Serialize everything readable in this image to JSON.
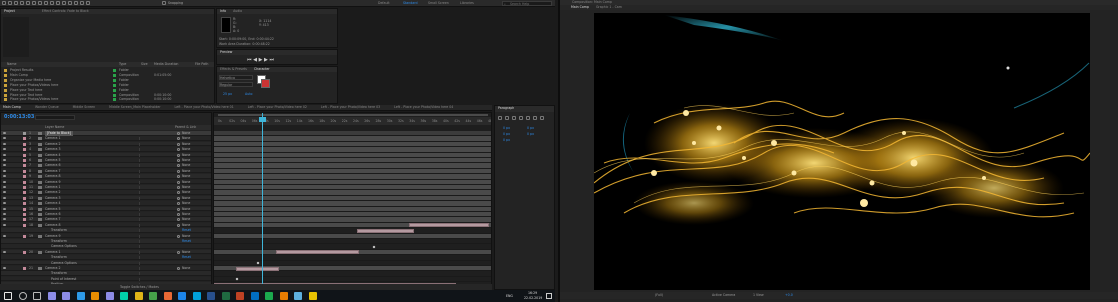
{
  "menubar": {
    "workspaces": [
      "Default",
      "Standard",
      "Small Screen",
      "Libraries"
    ],
    "active_workspace": "Standard",
    "snapping_label": "Snapping",
    "search_placeholder": "Search Help"
  },
  "project": {
    "title": "Project",
    "effect_controls_tab": "Effect Controls: Fade to Black",
    "columns": [
      "Name",
      "Type",
      "Size",
      "Media Duration",
      "File Path"
    ],
    "items": [
      {
        "name": "Project Results",
        "type": "Folder",
        "dur": ""
      },
      {
        "name": "Main Comp",
        "type": "Composition",
        "dur": "0:01:05:00"
      },
      {
        "name": "Organize your Media here",
        "type": "Folder",
        "dur": ""
      },
      {
        "name": "Place your Photos/Videos here",
        "type": "Folder",
        "dur": ""
      },
      {
        "name": "Place your Text here",
        "type": "Folder",
        "dur": ""
      },
      {
        "name": "Place your Text here",
        "type": "Composition",
        "dur": "0:00:10:00"
      },
      {
        "name": "Place your Photos/Videos here",
        "type": "Composition",
        "dur": "0:00:10:00"
      }
    ]
  },
  "info_panel": {
    "tabs": [
      "Info",
      "Audio"
    ],
    "lines": [
      "R:",
      "G:",
      "B:",
      "A: 0",
      "X: 1114",
      "Y: 413"
    ],
    "start_line": "Start: 0:00:09:00, End: 0:00:44:22",
    "work_line": "Work Area Duration: 0:00:48:22"
  },
  "preview_panel": {
    "title": "Preview"
  },
  "effects_panel": {
    "tabs": [
      "Effects & Presets",
      "Character"
    ],
    "font": "Helvetica",
    "style": "Regular",
    "size": "25 px",
    "leading": "Auto"
  },
  "timeline_tabs": [
    "Main Comp",
    "Wonder Queue",
    "Middle Screen",
    "Middle Screen_Main Placeholder",
    "Left - Place your Photo/Video here 01",
    "Left - Place your Photo/Video here 02",
    "Left - Place your Photo/Video here 03",
    "Left - Place your Photo/Video here 04"
  ],
  "timeline": {
    "timecode": "0:00:13:03",
    "layer_header": "Layer Name",
    "parent_header": "Parent & Link",
    "ruler": [
      "0s",
      "02s",
      "04s",
      "06s",
      "08s",
      "10s",
      "12s",
      "14s",
      "16s",
      "18s",
      "20s",
      "22s",
      "24s",
      "26s",
      "28s",
      "30s",
      "32s",
      "34s",
      "36s",
      "38s",
      "40s",
      "42s",
      "44s",
      "46s",
      "48s"
    ],
    "layers": [
      {
        "num": "1",
        "name": "[Fade to Black]",
        "parent": "None",
        "kind": "layer"
      },
      {
        "num": "2",
        "name": "Camera 1",
        "parent": "None",
        "kind": "layer"
      },
      {
        "num": "3",
        "name": "Camera 2",
        "parent": "None",
        "kind": "layer"
      },
      {
        "num": "4",
        "name": "Camera 3",
        "parent": "None",
        "kind": "layer"
      },
      {
        "num": "5",
        "name": "Camera 4",
        "parent": "None",
        "kind": "layer"
      },
      {
        "num": "6",
        "name": "Camera 5",
        "parent": "None",
        "kind": "layer"
      },
      {
        "num": "7",
        "name": "Camera 6",
        "parent": "None",
        "kind": "layer"
      },
      {
        "num": "8",
        "name": "Camera 7",
        "parent": "None",
        "kind": "layer"
      },
      {
        "num": "9",
        "name": "Camera 8",
        "parent": "None",
        "kind": "layer"
      },
      {
        "num": "10",
        "name": "Camera 9",
        "parent": "None",
        "kind": "layer"
      },
      {
        "num": "11",
        "name": "Camera 1",
        "parent": "None",
        "kind": "layer"
      },
      {
        "num": "12",
        "name": "Camera 2",
        "parent": "None",
        "kind": "layer"
      },
      {
        "num": "13",
        "name": "Camera 3",
        "parent": "None",
        "kind": "layer"
      },
      {
        "num": "14",
        "name": "Camera 4",
        "parent": "None",
        "kind": "layer"
      },
      {
        "num": "15",
        "name": "Camera 5",
        "parent": "None",
        "kind": "layer"
      },
      {
        "num": "16",
        "name": "Camera 6",
        "parent": "None",
        "kind": "layer"
      },
      {
        "num": "17",
        "name": "Camera 7",
        "parent": "None",
        "kind": "layer"
      },
      {
        "num": "18",
        "name": "Camera 8",
        "parent": "None",
        "kind": "layer"
      },
      {
        "num": "",
        "name": "Transform",
        "parent": "Reset",
        "kind": "sub"
      },
      {
        "num": "19",
        "name": "Camera 9",
        "parent": "None",
        "kind": "layer"
      },
      {
        "num": "",
        "name": "Transform",
        "parent": "Reset",
        "kind": "sub"
      },
      {
        "num": "",
        "name": "Camera Options",
        "parent": "",
        "kind": "sub"
      },
      {
        "num": "20",
        "name": "Camera 1",
        "parent": "None",
        "kind": "layer"
      },
      {
        "num": "",
        "name": "Transform",
        "parent": "Reset",
        "kind": "sub"
      },
      {
        "num": "",
        "name": "Camera Options",
        "parent": "",
        "kind": "sub"
      },
      {
        "num": "21",
        "name": "Camera 2",
        "parent": "None",
        "kind": "layer"
      },
      {
        "num": "",
        "name": "Transform",
        "parent": "",
        "kind": "sub"
      },
      {
        "num": "",
        "name": "Point of Interest",
        "parent": "",
        "kind": "sub"
      },
      {
        "num": "",
        "name": "Position",
        "parent": "",
        "kind": "sub"
      }
    ],
    "footer": "Toggle Switches / Modes"
  },
  "paragraph_panel": {
    "title": "Paragraph",
    "fields": [
      "0 px",
      "0 px",
      "0 px",
      "0 px",
      "0 px"
    ]
  },
  "viewer": {
    "title": "Composition: Main Comp",
    "tabs": [
      "Main Comp",
      "Graphic 1 - Cam"
    ],
    "footer_items": [
      "(Full)",
      "Active Camera",
      "1 View",
      "+0.0"
    ]
  },
  "taskbar": {
    "time": "16:29",
    "date": "22.02.2019",
    "lang": "ENG",
    "icons": [
      {
        "name": "windows-start-icon",
        "color": "#ffffff"
      },
      {
        "name": "search-icon",
        "color": "#cccccc"
      },
      {
        "name": "task-view-icon",
        "color": "#cccccc"
      },
      {
        "name": "after-effects-icon",
        "color": "#9999ff"
      },
      {
        "name": "premiere-icon",
        "color": "#9999ff"
      },
      {
        "name": "photoshop-icon",
        "color": "#31a8ff"
      },
      {
        "name": "illustrator-icon",
        "color": "#ff9a00"
      },
      {
        "name": "media-encoder-icon",
        "color": "#9999ff"
      },
      {
        "name": "audition-icon",
        "color": "#00e4bb"
      },
      {
        "name": "file-explorer-icon",
        "color": "#f5c518"
      },
      {
        "name": "chrome-icon",
        "color": "#4caf50"
      },
      {
        "name": "firefox-icon",
        "color": "#ff7139"
      },
      {
        "name": "edge-icon",
        "color": "#1e90ff"
      },
      {
        "name": "skype-icon",
        "color": "#00aff0"
      },
      {
        "name": "word-icon",
        "color": "#2b579a"
      },
      {
        "name": "excel-icon",
        "color": "#217346"
      },
      {
        "name": "powerpoint-icon",
        "color": "#d24726"
      },
      {
        "name": "outlook-icon",
        "color": "#0078d4"
      },
      {
        "name": "spotify-icon",
        "color": "#1db954"
      },
      {
        "name": "vlc-icon",
        "color": "#ff8800"
      },
      {
        "name": "steam-icon",
        "color": "#66c0f4"
      },
      {
        "name": "notes-icon",
        "color": "#ffd400"
      }
    ]
  },
  "colors": {
    "accent": "#2d8ceb",
    "playhead": "#3fb5d9",
    "layer_bar": "#b49aa0",
    "glow": "#f7b41a",
    "teal_line": "#35c8e6"
  }
}
